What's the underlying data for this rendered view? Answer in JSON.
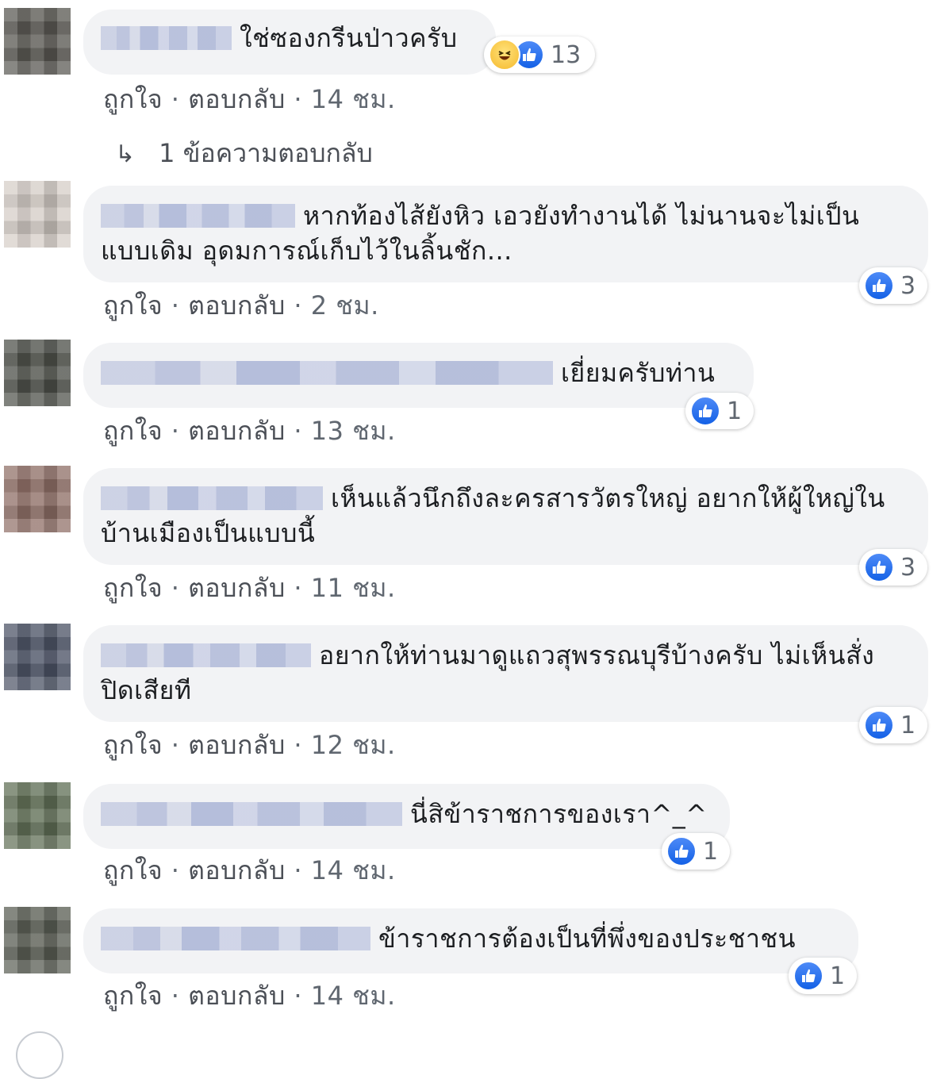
{
  "actions": {
    "like": "ถูกใจ",
    "reply": "ตอบกลับ",
    "sep": "·"
  },
  "colors": {
    "bubble": "#f2f3f5",
    "like_blue": "#1461e6",
    "meta_gray": "#606770"
  },
  "comments": [
    {
      "text": "ใช่ซองกรีนป่าวครับ",
      "time": "14 ชม.",
      "likes": "13",
      "reactions": [
        "haha-icon",
        "like-icon"
      ],
      "replies_label": "1 ข้อความตอบกลับ"
    },
    {
      "text": "หากท้องไส้ยังหิว เอวยังทำงานได้ ไม่นานจะไม่เป็นแบบเดิม อุดมการณ์เก็บไว้ในลิ้นชัก...",
      "time": "2 ชม.",
      "likes": "3"
    },
    {
      "text": "เยี่ยมครับท่าน",
      "time": "13 ชม.",
      "likes": "1"
    },
    {
      "text": "เห็นแล้วนึกถึงละครสารวัตรใหญ่ อยากให้ผู้ใหญ่ในบ้านเมืองเป็นแบบนี้",
      "time": "11 ชม.",
      "likes": "3"
    },
    {
      "text": "อยากให้ท่านมาดูแถวสุพรรณบุรีบ้างครับ ไม่เห็นสั่งปิดเสียที",
      "time": "12 ชม.",
      "likes": "1"
    },
    {
      "text": "นี่สิข้าราชการของเรา^_^",
      "time": "14 ชม.",
      "likes": "1"
    },
    {
      "text": "ข้าราชการต้องเป็นที่พึ่งของประชาชน",
      "time": "14 ชม.",
      "likes": "1"
    }
  ]
}
